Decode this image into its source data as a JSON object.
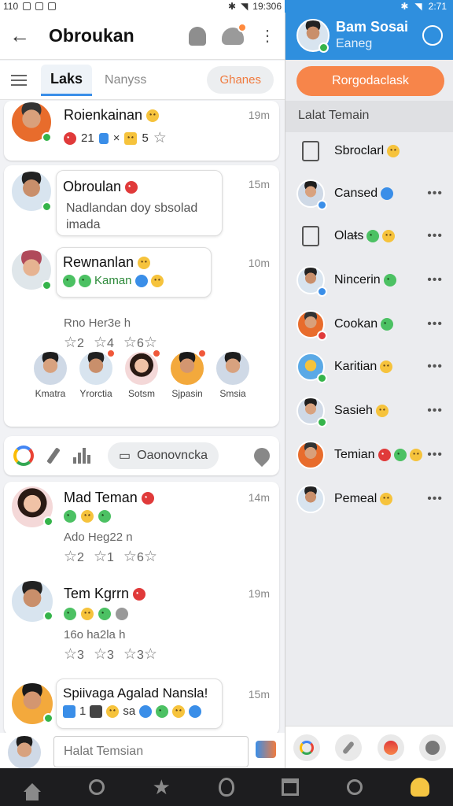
{
  "status": {
    "left_text": "110",
    "left_time": "19:306",
    "right_time": "2:71"
  },
  "header": {
    "title": "Obroukan"
  },
  "tabs": {
    "active": "Laks",
    "inactive": "Nanyss",
    "action": "Ghanes"
  },
  "posts": [
    {
      "name": "Roienkainan",
      "time": "19m",
      "count_a": "21",
      "count_b": "5"
    },
    {
      "name": "Obroulan",
      "time": "15m",
      "bubble": "Nadlandan doy sbsolad imada"
    },
    {
      "name": "Rewnanlan",
      "time": "10m",
      "tag": "Kaman",
      "meta": "Rno Her3e h",
      "stars": [
        "2",
        "4",
        "6"
      ]
    }
  ],
  "people": [
    {
      "label": "Kmatra"
    },
    {
      "label": "Yrorctia"
    },
    {
      "label": "Sotsm"
    },
    {
      "label": "Sjpasin"
    },
    {
      "label": "Smsia"
    }
  ],
  "actionbar": {
    "pill": "Oaonovncka"
  },
  "feed2": [
    {
      "name": "Mad Teman",
      "time": "14m",
      "meta": "Ado Heg22 n",
      "stars": [
        "2",
        "1",
        "6"
      ]
    },
    {
      "name": "Tem Kgrrn",
      "time": "19m",
      "meta": "16o ha2la h",
      "stars": [
        "3",
        "3",
        "3"
      ]
    },
    {
      "name": "Spiivaga Agalad Nansla!",
      "time": "15m",
      "count": "1",
      "tag": "sa"
    }
  ],
  "compose": {
    "placeholder": "Halat Temsian"
  },
  "right": {
    "profile_name": "Bam Sosai",
    "profile_sub": "Eaneg",
    "button": "Rorgodaclask",
    "section": "Lalat Temain",
    "items": [
      {
        "label": "Sbroclarl"
      },
      {
        "label": "Cansed"
      },
      {
        "label": "Olaᵵs"
      },
      {
        "label": "Nincerin"
      },
      {
        "label": "Cookan"
      },
      {
        "label": "Karitian"
      },
      {
        "label": "Sasieh"
      },
      {
        "label": "Temian"
      },
      {
        "label": "Pemeal"
      }
    ]
  },
  "colors": {
    "accent_blue": "#2f8fde",
    "accent_orange": "#f7854a",
    "online_green": "#35b44a"
  }
}
